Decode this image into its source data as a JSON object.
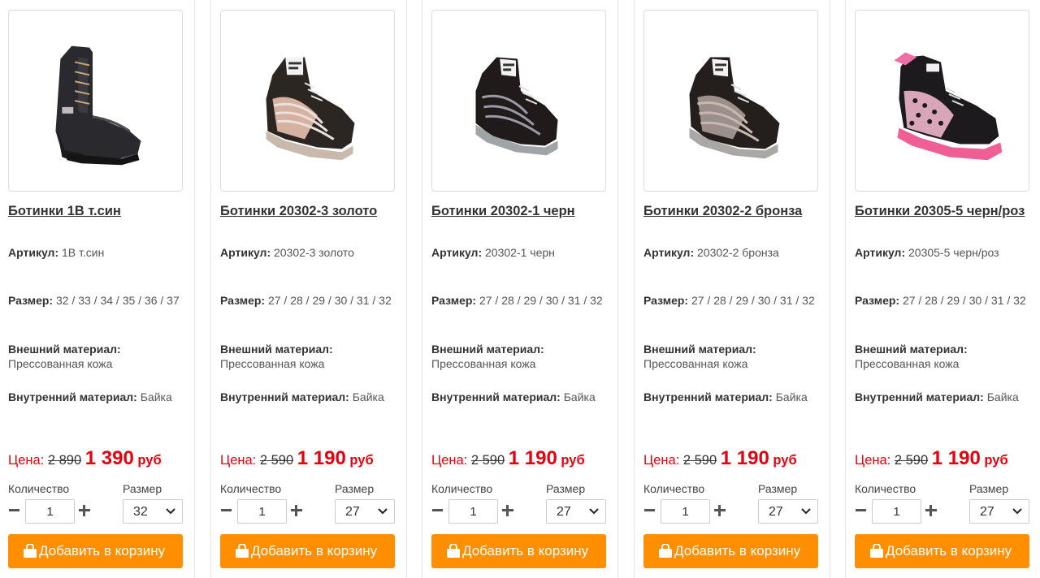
{
  "labels": {
    "article": "Артикул:",
    "size": "Размер:",
    "outer": "Внешний материал:",
    "inner": "Внутренний материал:",
    "price": "Цена:",
    "currency": "руб",
    "quantity": "Количество",
    "size_select": "Размер",
    "add_to_cart": "Добавить в корзину"
  },
  "products": [
    {
      "title": "Ботинки 1В т.син",
      "article": "1В т.син",
      "sizes": "32 / 33 / 34 / 35 / 36 / 37",
      "outer": "Прессованная кожа",
      "inner": "Байка",
      "old_price": "2 890",
      "new_price": "1 390",
      "qty": "1",
      "size_selected": "32",
      "image": "dark-lace-boot-icon"
    },
    {
      "title": "Ботинки 20302-3 золото",
      "article": "20302-3 золото",
      "sizes": "27 / 28 / 29 / 30 / 31 / 32",
      "outer": "Прессованная кожа",
      "inner": "Байка",
      "old_price": "2 590",
      "new_price": "1 190",
      "qty": "1",
      "size_selected": "27",
      "image": "gold-sneaker-boot-icon"
    },
    {
      "title": "Ботинки 20302-1 черн",
      "article": "20302-1 черн",
      "sizes": "27 / 28 / 29 / 30 / 31 / 32",
      "outer": "Прессованная кожа",
      "inner": "Байка",
      "old_price": "2 590",
      "new_price": "1 190",
      "qty": "1",
      "size_selected": "27",
      "image": "black-sneaker-boot-icon"
    },
    {
      "title": "Ботинки 20302-2 бронза",
      "article": "20302-2 бронза",
      "sizes": "27 / 28 / 29 / 30 / 31 / 32",
      "outer": "Прессованная кожа",
      "inner": "Байка",
      "old_price": "2 590",
      "new_price": "1 190",
      "qty": "1",
      "size_selected": "27",
      "image": "bronze-sneaker-boot-icon"
    },
    {
      "title": "Ботинки 20305-5 черн/роз",
      "article": "20305-5 черн/роз",
      "sizes": "27 / 28 / 29 / 30 / 31 / 32",
      "outer": "Прессованная кожа",
      "inner": "Байка",
      "old_price": "2 590",
      "new_price": "1 190",
      "qty": "1",
      "size_selected": "27",
      "image": "pink-black-sneaker-boot-icon"
    }
  ],
  "colors": {
    "price_red": "#e3000f",
    "button_orange": "#ff8f00"
  }
}
